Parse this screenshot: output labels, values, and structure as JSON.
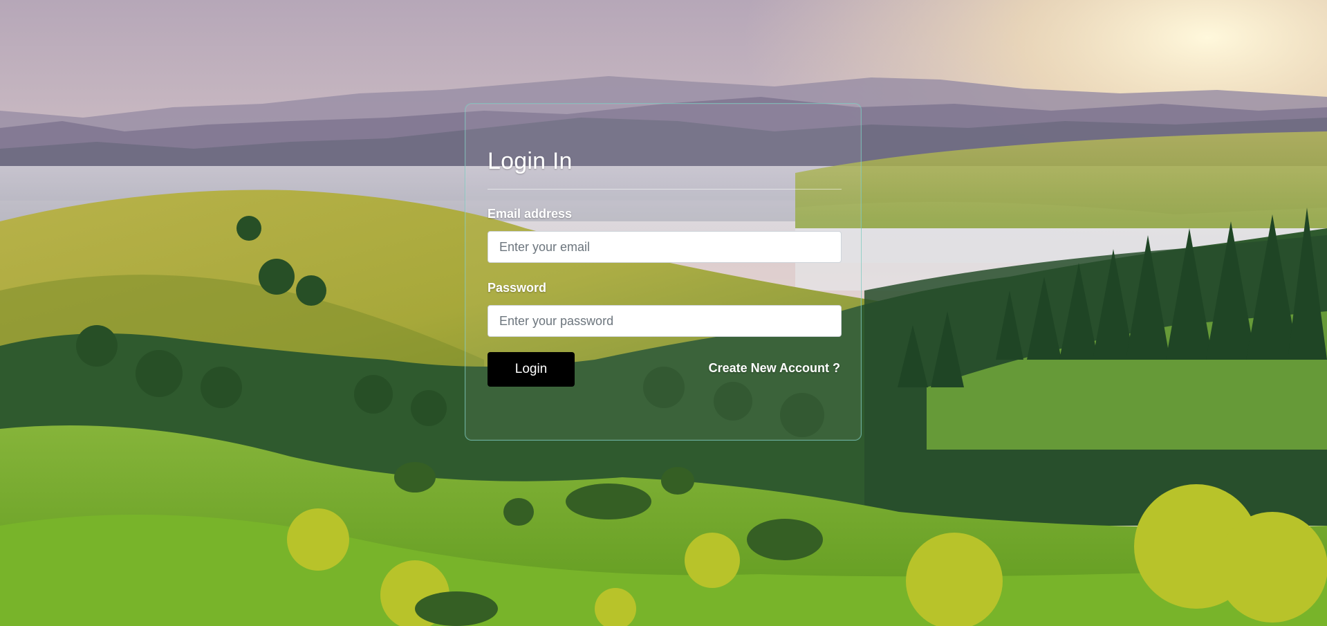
{
  "page": {
    "background": "mountain-valley-landscape",
    "accent_border": "#78c8be"
  },
  "login": {
    "title": "Login In",
    "email": {
      "label": "Email address",
      "placeholder": "Enter your email",
      "value": ""
    },
    "password": {
      "label": "Password",
      "placeholder": "Enter your password",
      "value": ""
    },
    "submit_label": "Login",
    "create_account_label": "Create New Account ?"
  },
  "colors": {
    "button_bg": "#000000",
    "button_text": "#ffffff",
    "label_text": "#ffffff"
  }
}
